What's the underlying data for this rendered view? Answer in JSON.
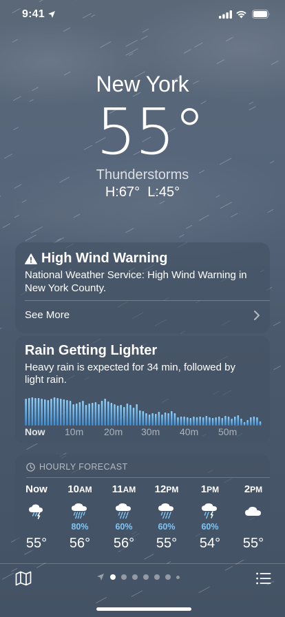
{
  "status_bar": {
    "time": "9:41"
  },
  "location": {
    "city": "New York",
    "temperature": "55°",
    "condition": "Thunderstorms",
    "hi_lo": "H:67°  L:45°"
  },
  "warning": {
    "title": "High Wind Warning",
    "body": "National Weather Service: High Wind Warning in New York County.",
    "see_more": "See More"
  },
  "rain": {
    "title": "Rain Getting Lighter",
    "body": "Heavy rain is expected for 34 min, followed by light rain.",
    "axis_labels": [
      "Now",
      "10m",
      "20m",
      "30m",
      "40m",
      "50m"
    ],
    "intensity": [
      0.78,
      0.8,
      0.82,
      0.8,
      0.8,
      0.78,
      0.76,
      0.74,
      0.78,
      0.82,
      0.8,
      0.78,
      0.76,
      0.74,
      0.72,
      0.62,
      0.64,
      0.68,
      0.72,
      0.6,
      0.64,
      0.66,
      0.68,
      0.62,
      0.72,
      0.78,
      0.7,
      0.66,
      0.62,
      0.58,
      0.6,
      0.54,
      0.64,
      0.6,
      0.52,
      0.62,
      0.44,
      0.42,
      0.36,
      0.32,
      0.36,
      0.34,
      0.4,
      0.32,
      0.38,
      0.36,
      0.42,
      0.36,
      0.24,
      0.26,
      0.26,
      0.24,
      0.22,
      0.26,
      0.24,
      0.26,
      0.24,
      0.28,
      0.24,
      0.22,
      0.24,
      0.26,
      0.22,
      0.28,
      0.26,
      0.2,
      0.26,
      0.3,
      0.2,
      0.1,
      0.16,
      0.24,
      0.26,
      0.24,
      0.12
    ]
  },
  "hourly": {
    "header": "HOURLY FORECAST",
    "items": [
      {
        "hour": "Now",
        "suffix": "",
        "icon": "thunderstorm-icon",
        "pct": "",
        "temp": "55°"
      },
      {
        "hour": "10",
        "suffix": "AM",
        "icon": "heavy-rain-icon",
        "pct": "80%",
        "temp": "56°"
      },
      {
        "hour": "11",
        "suffix": "AM",
        "icon": "rain-icon",
        "pct": "60%",
        "temp": "56°"
      },
      {
        "hour": "12",
        "suffix": "PM",
        "icon": "rain-icon",
        "pct": "60%",
        "temp": "55°"
      },
      {
        "hour": "1",
        "suffix": "PM",
        "icon": "thunder-rain-icon",
        "pct": "60%",
        "temp": "54°"
      },
      {
        "hour": "2",
        "suffix": "PM",
        "icon": "cloud-icon",
        "pct": "",
        "temp": "55°"
      }
    ]
  },
  "pager": {
    "pages": 7,
    "current": 0
  }
}
